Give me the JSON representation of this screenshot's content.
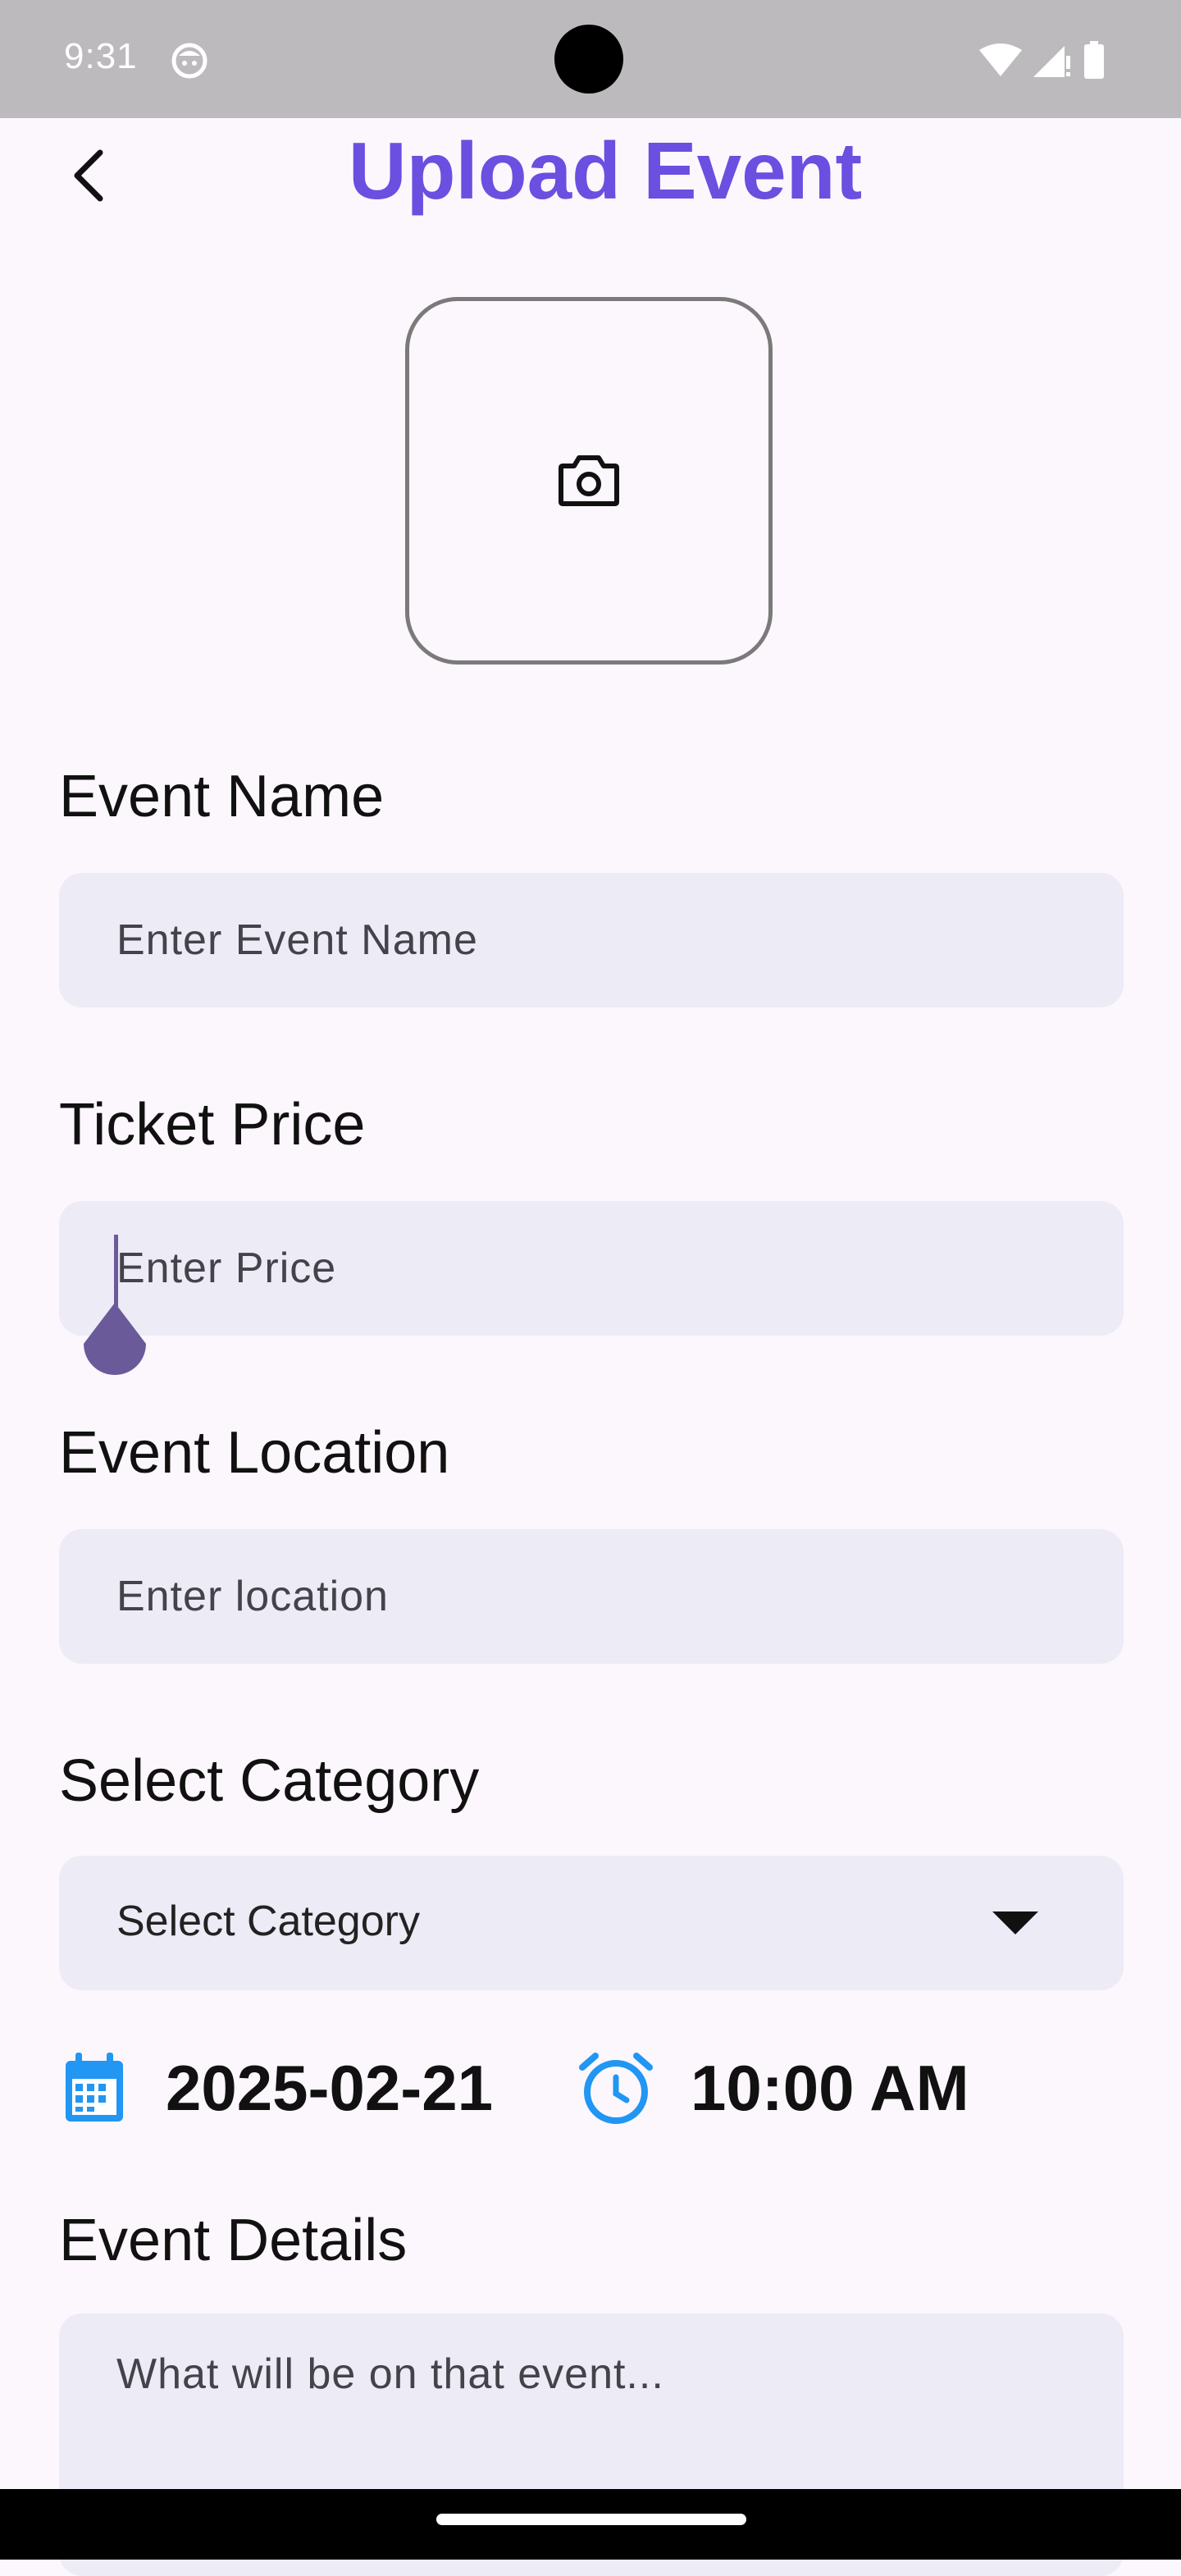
{
  "status_bar": {
    "time": "9:31",
    "icons": [
      "app-notification-icon",
      "wifi-icon",
      "signal-icon",
      "battery-icon"
    ]
  },
  "header": {
    "title": "Upload Event",
    "back_icon": "chevron-left-icon",
    "title_color": "#6A4FE0"
  },
  "image_picker": {
    "icon": "camera-icon"
  },
  "form": {
    "event_name": {
      "label": "Event Name",
      "placeholder": "Enter Event Name",
      "value": ""
    },
    "ticket_price": {
      "label": "Ticket Price",
      "placeholder": "Enter Price",
      "value": ""
    },
    "event_location": {
      "label": "Event Location",
      "placeholder": "Enter location",
      "value": ""
    },
    "category": {
      "label": "Select Category",
      "selected": "Select Category"
    },
    "date": {
      "value": "2025-02-21",
      "icon": "calendar-icon"
    },
    "time": {
      "value": "10:00 AM",
      "icon": "alarm-clock-icon"
    },
    "details": {
      "label": "Event Details",
      "placeholder": "What will be on that event...",
      "value": ""
    }
  },
  "colors": {
    "background": "#FCF7FC",
    "input_fill": "#ECEBF6",
    "accent_blue": "#2196F3",
    "cursor": "#6A5A99"
  }
}
